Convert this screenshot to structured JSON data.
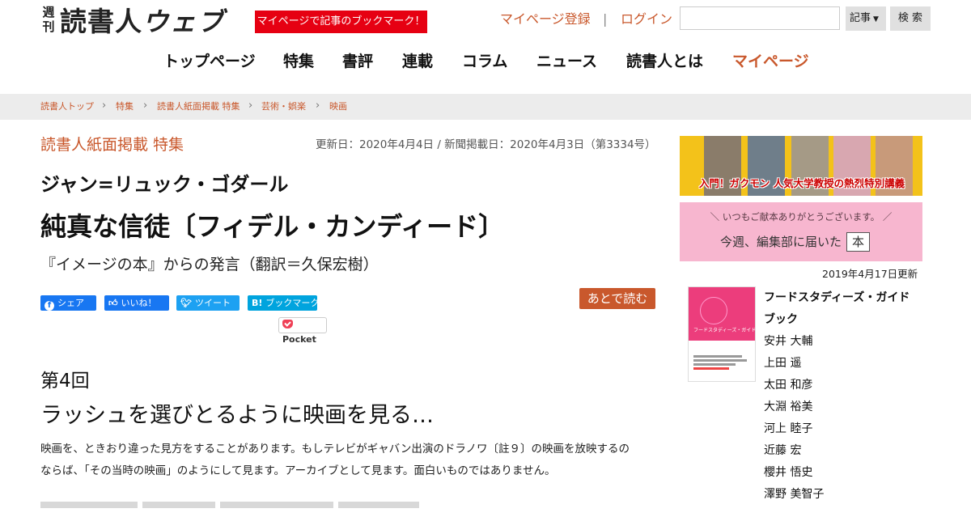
{
  "header": {
    "logo_weekly": "週刊",
    "logo_main": "読書人",
    "logo_web": "ウェブ",
    "promo": "マイページで記事のブックマーク！",
    "register": "マイページ登録",
    "separator": "|",
    "login": "ログイン",
    "search_placeholder": "",
    "select_value": "記事",
    "search_button": "検 索"
  },
  "nav": [
    "トップページ",
    "特集",
    "書評",
    "連載",
    "コラム",
    "ニュース",
    "読書人とは",
    "マイページ"
  ],
  "breadcrumb": [
    "読書人トップ",
    "特集",
    "読書人紙面掲載 特集",
    "芸術・娯楽",
    "映画"
  ],
  "article": {
    "category": "読書人紙面掲載 特集",
    "dates": "更新日：2020年4月4日 / 新聞掲載日：2020年4月3日（第3334号）",
    "subject": "ジャン=リュック・ゴダール",
    "title": "純真な信徒〔フィデル・カンディード〕",
    "subtitle": "『イメージの本』からの発言（翻訳＝久保宏樹）",
    "share": {
      "facebook": "シェア",
      "like": "いいね！",
      "tweet": "ツイート",
      "hatena_icon": "B!",
      "hatena": "ブックマーク",
      "pocket": "Pocket",
      "read_later": "あとで読む"
    },
    "chapter": "第4回",
    "heading": "ラッシュを選びとるように映画を見る…",
    "body": [
      "映画を、ときおり違った見方をすることがあります。もしテレビがギャバン出演のドラノワ〔註９〕の映画を放映するの",
      "ならば、「その当時の映画」のようにして見ます。アーカイブとして見ます。面白いものではありません。"
    ]
  },
  "sidebar": {
    "banner1_text": "入門！ガクモン 人気大学教授の熱烈特別講義",
    "banner2_top": "＼ いつもご献本ありがとうございます。 ／",
    "banner2_main": "今週、編集部に届いた",
    "banner2_book": "本",
    "updated": "2019年4月17日更新",
    "book_title": "フードスタディーズ・ガイドブック",
    "cover_title": "フードスタディーズ・ガイドブック",
    "authors": [
      "安井 大輔",
      "上田 遥",
      "太田 和彦",
      "大淵 裕美",
      "河上 睦子",
      "近藤 宏",
      "櫻井 悟史",
      "澤野 美智子"
    ]
  },
  "colors": {
    "accent": "#c9582c",
    "promo_red": "#e60012",
    "facebook": "#1877f2",
    "twitter": "#1da1f2",
    "hatena": "#00a4de",
    "breadcrumb_bg": "#ececec",
    "banner_yellow": "#f3c21a",
    "banner_pink": "#f7b6cf"
  }
}
